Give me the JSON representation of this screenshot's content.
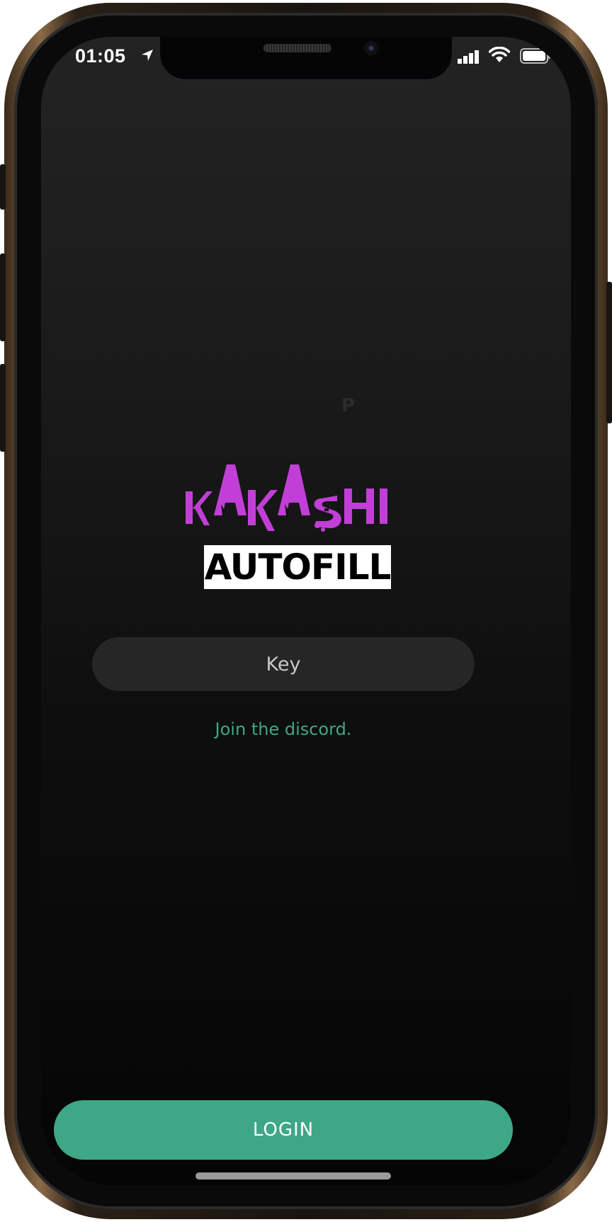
{
  "status_bar": {
    "time": "01:05",
    "icons": [
      "location-arrow-icon",
      "cellular-signal-icon",
      "wifi-icon",
      "battery-icon"
    ]
  },
  "logo": {
    "line1": "KAKASHI",
    "line2": "AUTOFILL",
    "accent_color": "#c13fd6"
  },
  "key_field": {
    "placeholder": "Key",
    "value": ""
  },
  "discord_link": {
    "label": "Join the discord."
  },
  "login_button": {
    "label": "LOGIN",
    "color": "#3ea786"
  },
  "artifact": {
    "glyph": "P"
  }
}
